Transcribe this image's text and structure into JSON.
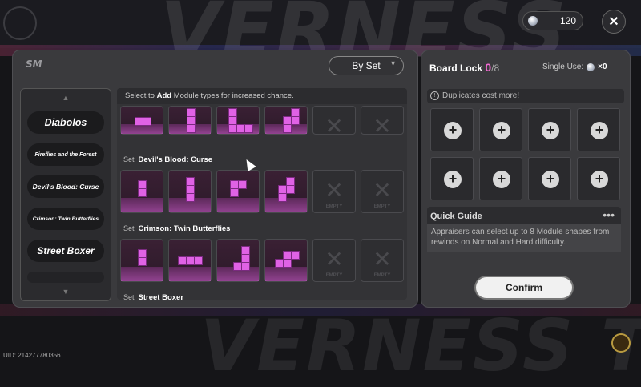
{
  "background": {
    "word_top": "VERNESS",
    "word_bottom": "VERNESS TO EVE"
  },
  "topbar": {
    "currency_value": "120",
    "close_label": "✕"
  },
  "left": {
    "header_logo": "SM",
    "dropdown_label": "By Set",
    "hint_prefix": "Select to ",
    "hint_bold": "Add",
    "hint_suffix": " Module types for increased chance.",
    "sidebar_items": [
      {
        "label": "Diabolos",
        "size": "big"
      },
      {
        "label": "Fireflies and the Forest",
        "size": "small"
      },
      {
        "label": "Devil's Blood: Curse",
        "size": "mid"
      },
      {
        "label": "Crimson: Twin Butterflies",
        "size": "small"
      },
      {
        "label": "Street Boxer",
        "size": "big"
      }
    ],
    "set_prefix": "Set",
    "sets": [
      {
        "name": "Devil's Blood: Curse"
      },
      {
        "name": "Crimson: Twin Butterflies"
      },
      {
        "name": "Street Boxer"
      }
    ],
    "empty_label": "EMPTY"
  },
  "right": {
    "board_lock_label": "Board Lock ",
    "board_lock_current": "0",
    "board_lock_max": "/8",
    "single_use_label": "Single Use:",
    "single_use_count": "×0",
    "duplicates_text": "Duplicates cost more!",
    "guide_title": "Quick Guide",
    "guide_more": "•••",
    "guide_text": "Appraisers can select up to 8 Module shapes from rewinds on Normal and Hard difficulty.",
    "confirm_label": "Confirm"
  },
  "footer": {
    "uid": "UID: 214277780356"
  },
  "colors": {
    "accent": "#f06ad0",
    "module_pink": "#e062e5",
    "panel": "#3a3a3d"
  }
}
